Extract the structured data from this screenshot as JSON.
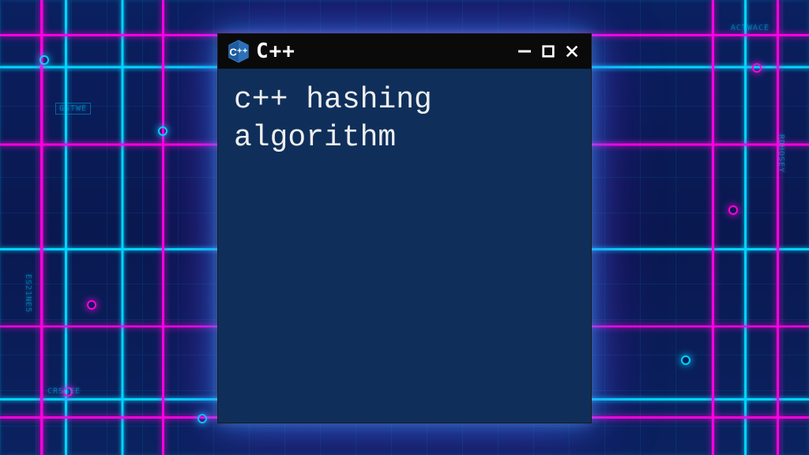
{
  "window": {
    "title": "C++",
    "icon_name": "cpp-hexagon-icon",
    "controls": {
      "minimize": "–",
      "maximize": "▢",
      "close": "✕"
    }
  },
  "content": {
    "text": "c++ hashing\nalgorithm"
  },
  "background": {
    "labels": {
      "topright": "ACTWACE",
      "bottomleft": "CRSGEE",
      "topleft": "GSTWE",
      "leftside": "ES21NE5",
      "rightside": "RDHOSEY"
    }
  },
  "colors": {
    "window_bg": "#0f2f5a",
    "titlebar_bg": "#0a0a0a",
    "text": "#eeeeee",
    "cyan": "#00d4ff",
    "magenta": "#ff00dd"
  }
}
